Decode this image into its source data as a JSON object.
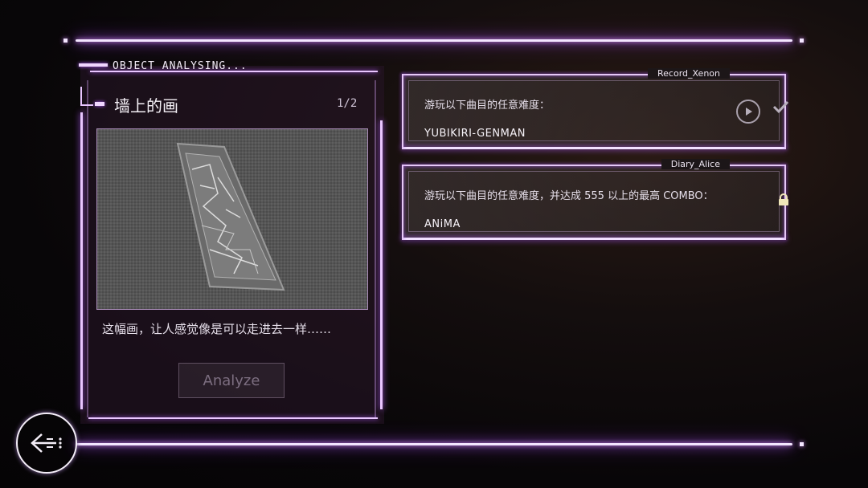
{
  "panel": {
    "header": "OBJECT ANALYSING...",
    "title": "墙上的画",
    "page": "1/2",
    "description": "这幅画，让人感觉像是可以走进去一样……",
    "analyze_label": "Analyze"
  },
  "quests": [
    {
      "tag": "Record_Xenon",
      "description": "游玩以下曲目的任意难度：",
      "song": "YUBIKIRI-GENMAN",
      "status": "completed",
      "icons": [
        "play-icon",
        "check-icon"
      ]
    },
    {
      "tag": "Diary_Alice",
      "description": "游玩以下曲目的任意难度，并达成 555 以上的最高 COMBO：",
      "song": "ANiMA",
      "status": "locked",
      "icons": [
        "lock-icon"
      ]
    }
  ],
  "back_icon": "back-arrow-icon",
  "colors": {
    "glow": "#b25cff",
    "line": "#f4e6ff"
  }
}
